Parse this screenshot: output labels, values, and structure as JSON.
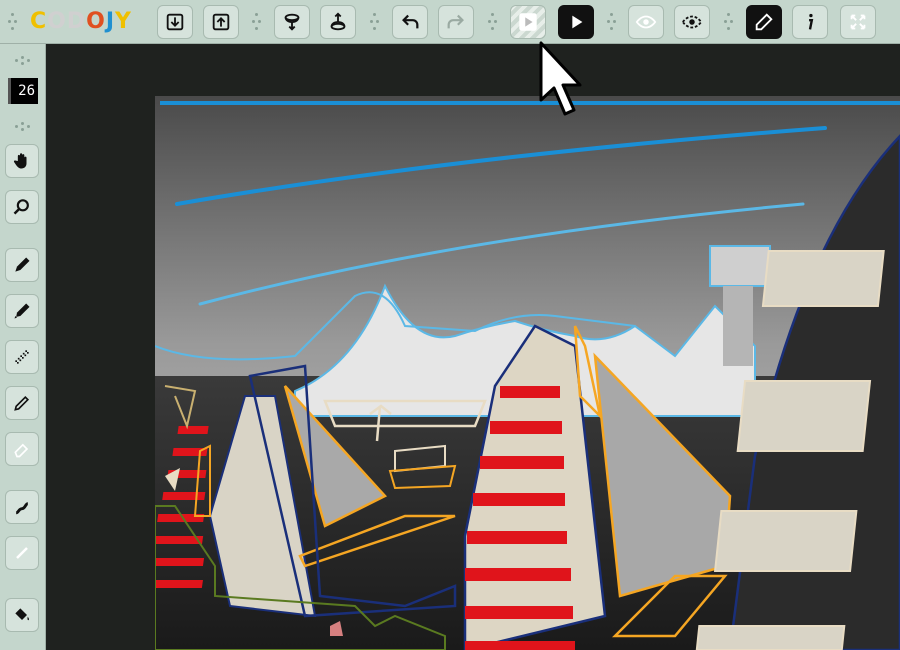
{
  "app": {
    "logo_letters": [
      "C",
      "O",
      "D",
      "O",
      "J",
      "Y"
    ],
    "logo_colors": [
      "#f0c000",
      "#e06020",
      "#2080d0",
      "#c03030",
      "#40a040",
      "#f0c000"
    ]
  },
  "toolbar": {
    "buttons": [
      {
        "name": "import-icon"
      },
      {
        "name": "export-icon"
      },
      {
        "name": "load-icon"
      },
      {
        "name": "save-icon"
      },
      {
        "name": "undo-icon"
      },
      {
        "name": "redo-icon"
      },
      {
        "name": "play-outline-icon"
      },
      {
        "name": "play-icon"
      },
      {
        "name": "eye-icon"
      },
      {
        "name": "eye-off-icon"
      },
      {
        "name": "edit-icon"
      },
      {
        "name": "info-icon"
      },
      {
        "name": "fullscreen-icon"
      }
    ]
  },
  "leftbar": {
    "brush_size": "26",
    "tools": [
      "hand-icon",
      "zoom-icon",
      "marker-icon",
      "brush-icon",
      "dither-brush-icon",
      "pencil-icon",
      "eraser-icon",
      "curve-icon",
      "line-icon",
      "fill-icon"
    ]
  },
  "colors": {
    "toolbar_bg": "#c4d6cc",
    "canvas_bg": "#1f221f",
    "annotation_blue": "#1a8fd6",
    "annotation_lightblue": "#5bb8e6",
    "annotation_orange": "#f5a623",
    "annotation_red": "#e0141b",
    "annotation_navy": "#1a2f7a",
    "annotation_green": "#5a7a20",
    "annotation_beige": "#e8dcc4"
  }
}
